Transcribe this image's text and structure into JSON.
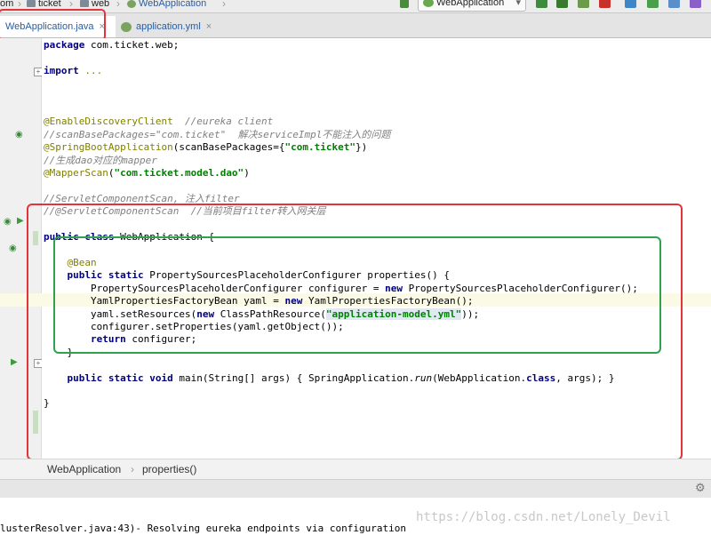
{
  "breadcrumb": {
    "items": [
      "om",
      "ticket",
      "web",
      "WebApplication"
    ]
  },
  "run_config": {
    "label": "WebApplication"
  },
  "tabs": [
    {
      "label": "WebApplication.java",
      "close": "×"
    },
    {
      "label": "application.yml",
      "close": "×"
    }
  ],
  "code": {
    "l1_kw": "package",
    "l1_rest": " com.ticket.web;",
    "l2_kw": "import",
    "l2_rest": " ...",
    "l3_an": "@EnableDiscoveryClient",
    "l3_cm": "  //eureka client",
    "l4": "//scanBasePackages=\"com.ticket\"  解决serviceImpl不能注入的问题",
    "l5_an": "@SpringBootApplication",
    "l5_a": "(scanBasePackages={",
    "l5_st": "\"com.ticket\"",
    "l5_b": "})",
    "l6": "//生成dao对应的mapper",
    "l7_an": "@MapperScan",
    "l7_a": "(",
    "l7_st": "\"com.ticket.model.dao\"",
    "l7_b": ")",
    "l8": "//ServletComponentScan, 注入filter",
    "l9": "//@ServletComponentScan  //当前项目filter转入网关层",
    "l10_kw": "public class",
    "l10_rest": " WebApplication {",
    "l11_an": "@Bean",
    "l12_kw1": "public static",
    "l12_rest": " PropertySourcesPlaceholderConfigurer properties() {",
    "l13_a": "PropertySourcesPlaceholderConfigurer configurer = ",
    "l13_kw": "new",
    "l13_b": " PropertySourcesPlaceholderConfigurer();",
    "l14_a": "YamlPropertiesFactoryBean yaml = ",
    "l14_kw": "new",
    "l14_b": " YamlPropertiesFactoryBean();",
    "l15_a": "yaml.setResources(",
    "l15_kw": "new",
    "l15_b": " ClassPathResource(",
    "l15_st": "\"application-model.yml\"",
    "l15_c": "));",
    "l16": "configurer.setProperties(yaml.getObject());",
    "l17_kw": "return",
    "l17_rest": " configurer;",
    "l18": "}",
    "l19_kw1": "public static void",
    "l19_a": " main(String[] args) { SpringApplication.",
    "l19_it": "run",
    "l19_b": "(WebApplication.",
    "l19_kw2": "class",
    "l19_c": ", args); }",
    "l20": "}"
  },
  "navbar": {
    "items": [
      "WebApplication",
      "properties()"
    ],
    "sep": "›"
  },
  "console": {
    "line": "lusterResolver.java:43)- Resolving eureka endpoints via configuration"
  },
  "watermark": "https://blog.csdn.net/Lonely_Devil"
}
